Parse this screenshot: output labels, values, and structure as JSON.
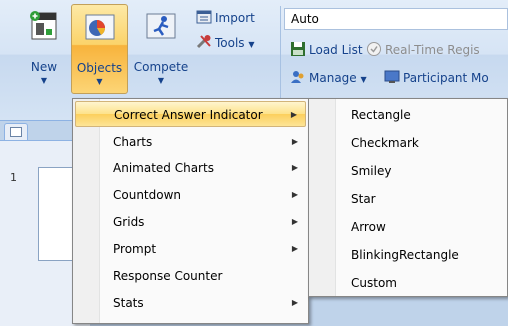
{
  "ribbon": {
    "new_label": "New",
    "objects_label": "Objects",
    "compete_label": "Compete",
    "import_label": "Import",
    "tools_label": "Tools",
    "combo_value": "Auto",
    "load_list_label": "Load List",
    "realtime_label": "Real-Time Regis",
    "manage_label": "Manage",
    "participant_label": "Participant Mo"
  },
  "document": {
    "slide_number": "1"
  },
  "objects_menu": {
    "items": [
      {
        "label": "Correct Answer Indicator",
        "has_submenu": true,
        "highlighted": true
      },
      {
        "label": "Charts",
        "has_submenu": true
      },
      {
        "label": "Animated Charts",
        "has_submenu": true
      },
      {
        "label": "Countdown",
        "has_submenu": true
      },
      {
        "label": "Grids",
        "has_submenu": true
      },
      {
        "label": "Prompt",
        "has_submenu": true
      },
      {
        "label": "Response Counter",
        "has_submenu": false
      },
      {
        "label": "Stats",
        "has_submenu": true
      }
    ]
  },
  "indicator_submenu": {
    "items": [
      {
        "label": "Rectangle"
      },
      {
        "label": "Checkmark"
      },
      {
        "label": "Smiley"
      },
      {
        "label": "Star"
      },
      {
        "label": "Arrow"
      },
      {
        "label": "BlinkingRectangle"
      },
      {
        "label": "Custom"
      }
    ]
  },
  "colors": {
    "ribbon_bg": "#d6e4f5",
    "highlight": "#fcd576",
    "menu_bg": "#fafafa",
    "text_blue": "#15428b"
  },
  "icons": [
    "new-icon",
    "objects-icon",
    "compete-icon",
    "import-icon",
    "tools-icon",
    "load-list-icon",
    "realtime-icon",
    "manage-icon",
    "participant-icon"
  ]
}
